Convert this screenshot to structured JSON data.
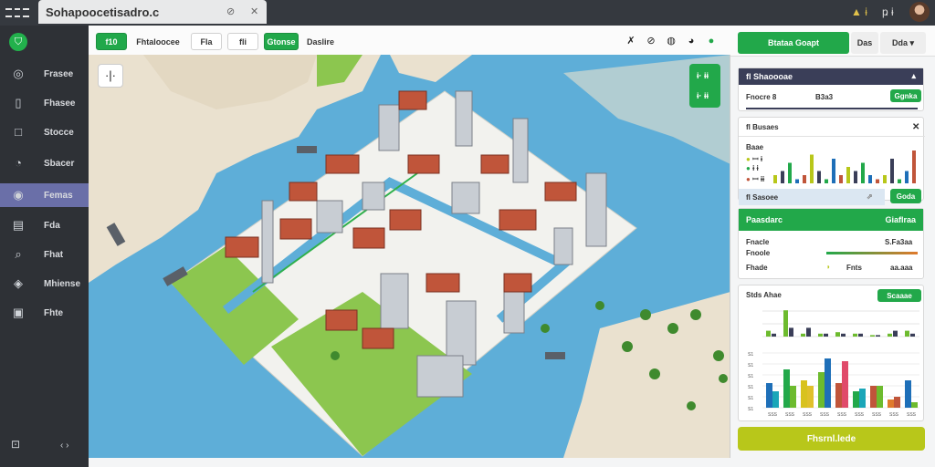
{
  "window": {
    "app_title": "Sohapoocetisadro.c",
    "tab_btn_a": "⊘",
    "tab_btn_b": "✕",
    "top_icon_a": "▲ ɨ",
    "top_icon_b": "ҏ ɨ"
  },
  "sidebar": {
    "items": [
      {
        "icon": "◎",
        "label": "Frasee"
      },
      {
        "icon": "▯",
        "label": "Fhasee"
      },
      {
        "icon": "□",
        "label": "Stocce"
      },
      {
        "icon": "◔",
        "label": "Sbacer"
      },
      {
        "icon": "◉",
        "label": "Femas"
      },
      {
        "icon": "▤",
        "label": "Fda"
      },
      {
        "icon": "⌕",
        "label": "Fhat"
      },
      {
        "icon": "◈",
        "label": "Mhiense"
      },
      {
        "icon": "▣",
        "label": "Fhte"
      }
    ],
    "bottom_icon": "⊡",
    "collapse": "‹ ›"
  },
  "toolbar": {
    "btn1": "f10",
    "btn2": "Fhtaloocee",
    "btn3": "Fla",
    "btn4": "fli",
    "btn5": "Gtonse",
    "btn6": "Daslire",
    "icons": [
      "✗",
      "⊘",
      "◍",
      "◕",
      "●"
    ]
  },
  "map": {
    "zoom_label": "·|·",
    "ctrl_a": "ɨ· ɨɨ",
    "ctrl_b": "ɨ· ɨɨ"
  },
  "right": {
    "top_green": "Btataa Goapt",
    "top_b": "Das",
    "top_c": "Dda ▾",
    "card1": {
      "head": "fl Shaoooae",
      "label": "Fnocre 8",
      "value": "B3a3",
      "button": "Ggnka"
    },
    "card2": {
      "head": "fl Busaes",
      "legend": "Baae",
      "legend_rows": [
        "ꟷ ɨ",
        "ɨ ɨ",
        "ꟷ ɨɨ"
      ],
      "bar_values": [
        2,
        3,
        5,
        1,
        2,
        7,
        3,
        1,
        6,
        2,
        4,
        3,
        5,
        2,
        1,
        2,
        6,
        1,
        3,
        8
      ],
      "filter": "fl Sasoee",
      "filter_btn": "Goda"
    },
    "card3": {
      "head": "Paasdarc",
      "head_right": "Giaflraa",
      "rows": [
        {
          "label": "Fnacle",
          "value": "S.Fa3aa"
        },
        {
          "label": "Fnoole",
          "value": ""
        },
        {
          "label": "Fhade",
          "value": "aa.aaa"
        }
      ],
      "mid": "Fnts"
    },
    "card4": {
      "title": "Stds Ahae",
      "button": "Scaaae",
      "top_bars": [
        {
          "name": "a",
          "values": [
            0.2,
            0.9,
            0.1,
            0.1,
            0.15,
            0.1,
            0.05,
            0.1,
            0.2
          ]
        },
        {
          "name": "b",
          "values": [
            0.1,
            0.3,
            0.3,
            0.1,
            0.1,
            0.1,
            0.05,
            0.2,
            0.1
          ]
        }
      ],
      "bottom_bars": [
        {
          "name": "s1",
          "values": [
            0.45,
            0.7,
            0.5,
            0.65,
            0.45,
            0.3,
            0.4,
            0.15,
            0.5
          ]
        },
        {
          "name": "s2",
          "values": [
            0.3,
            0.4,
            0.4,
            0.9,
            0.85,
            0.35,
            0.4,
            0.2,
            0.1
          ]
        }
      ],
      "y_ticks": [
        "S1",
        "S1",
        "S1",
        "S1",
        "S1",
        "S1"
      ],
      "x_ticks": [
        "SSS",
        "SSS",
        "SSS",
        "SSS",
        "SSS",
        "SSS",
        "SSS",
        "SSS",
        "SSS"
      ]
    },
    "bottom_button": "Fhsrnl.lede"
  },
  "colors": {
    "green": "#22a84a",
    "dark_sidebar": "#2e3136",
    "water": "#5eaed8",
    "land": "#eae1cf",
    "park": "#8cc64f",
    "accent": "#b8c71a"
  }
}
